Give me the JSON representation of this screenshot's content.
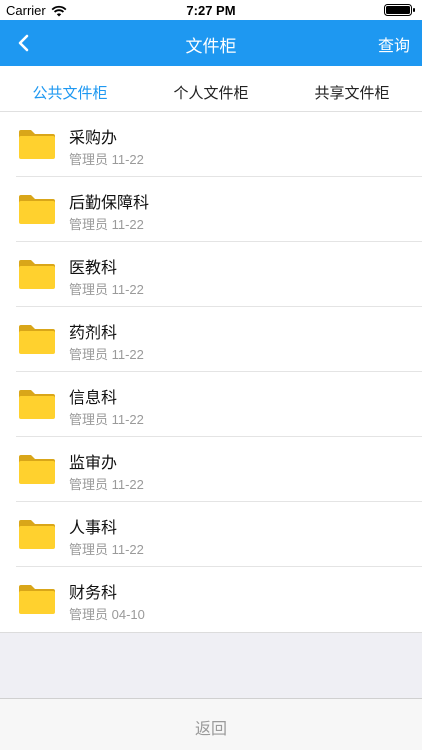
{
  "status": {
    "carrier": "Carrier",
    "time": "7:27 PM"
  },
  "nav": {
    "title": "文件柜",
    "action": "查询"
  },
  "tabs": [
    "公共文件柜",
    "个人文件柜",
    "共享文件柜"
  ],
  "active_tab": 0,
  "items": [
    {
      "name": "采购办",
      "meta": "管理员 11-22"
    },
    {
      "name": "后勤保障科",
      "meta": "管理员 11-22"
    },
    {
      "name": "医教科",
      "meta": "管理员 11-22"
    },
    {
      "name": "药剂科",
      "meta": "管理员 11-22"
    },
    {
      "name": "信息科",
      "meta": "管理员 11-22"
    },
    {
      "name": "监审办",
      "meta": "管理员 11-22"
    },
    {
      "name": "人事科",
      "meta": "管理员 11-22"
    },
    {
      "name": "财务科",
      "meta": "管理员 04-10"
    }
  ],
  "bottom": {
    "label": "返回"
  },
  "colors": {
    "accent": "#1e98f1",
    "folder": "#ffd12e"
  },
  "icons": {
    "back": "chevron-left-icon",
    "folder": "folder-icon",
    "wifi": "wifi-icon",
    "battery": "battery-icon"
  }
}
